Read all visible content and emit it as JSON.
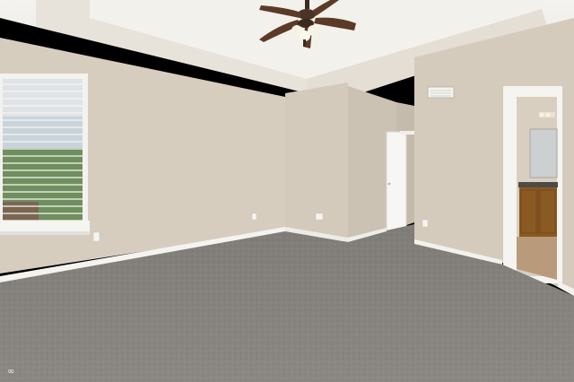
{
  "photo": {
    "subject": "empty-bedroom-with-ceiling-fan",
    "colors": {
      "wall": "#d6cdbf",
      "wall_shadow": "#c9c0b2",
      "ceiling": "#f1efea",
      "carpet": "#8b8782",
      "baseboard": "#f4f3ef",
      "door": "#f6f6f4",
      "fan_blade": "#5b3a26",
      "cabinet": "#8a5a22"
    }
  },
  "watermark": {
    "icon": "infinity-loop-icon",
    "text": "∞"
  }
}
